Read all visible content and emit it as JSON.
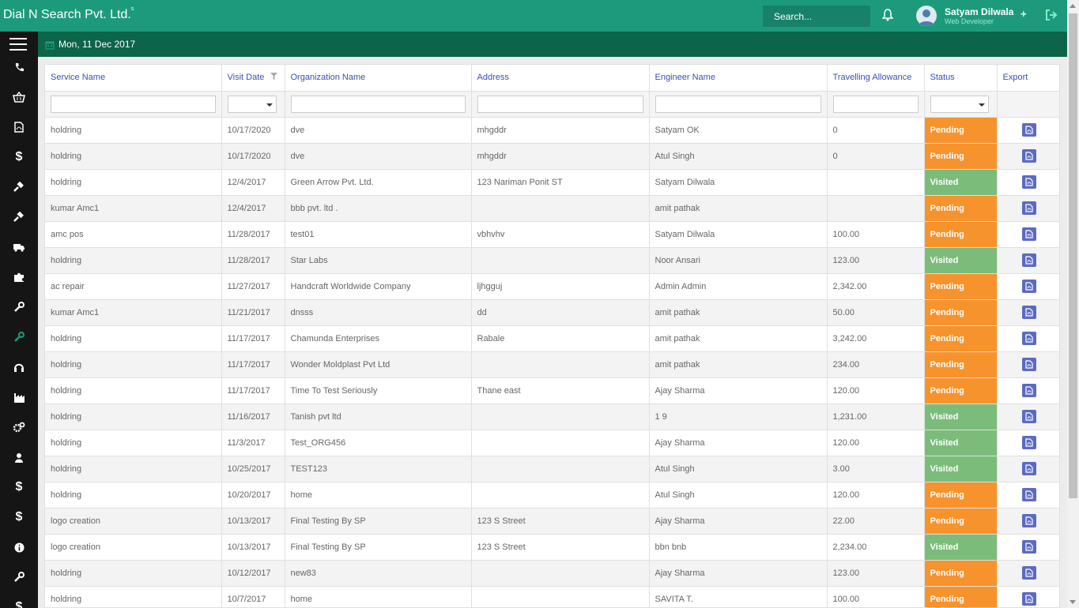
{
  "header": {
    "brand": "Dial N Search Pvt. Ltd.",
    "brand_sup": "s",
    "search_placeholder": "Search...",
    "user_name": "Satyam Dilwala",
    "user_role": "Web Developer",
    "accent_color": "#1d9a7c"
  },
  "subbar": {
    "date": "Mon, 11 Dec 2017",
    "color": "#0c6449"
  },
  "sidebar": {
    "icons": [
      "phone-icon",
      "basket-icon",
      "pdf-file-icon",
      "dollar-icon",
      "gavel-icon",
      "gavel-icon",
      "truck-icon",
      "puzzle-icon",
      "wrench-icon",
      "wrench-icon",
      "headphones-icon",
      "industry-icon",
      "cogs-icon",
      "user-icon",
      "dollar-icon",
      "dollar-icon",
      "info-icon",
      "wrench-icon",
      "dollar-icon"
    ]
  },
  "table": {
    "columns": [
      "Service Name",
      "Visit Date",
      "Organization Name",
      "Address",
      "Engineer Name",
      "Travelling Allowance",
      "Status",
      "Export"
    ],
    "rows": [
      [
        "holdring",
        "10/17/2020",
        "dve",
        "mhgddr",
        "Satyam OK",
        "0",
        "Pending"
      ],
      [
        "holdring",
        "10/17/2020",
        "dve",
        "mhgddr",
        "Atul Singh",
        "0",
        "Pending"
      ],
      [
        "holdring",
        "12/4/2017",
        "Green Arrow Pvt. Ltd.",
        "123 Nariman Ponit ST",
        "Satyam Dilwala",
        "",
        "Visited"
      ],
      [
        "kumar Amc1",
        "12/4/2017",
        "bbb pvt. ltd .",
        "",
        "amit pathak",
        "",
        "Pending"
      ],
      [
        "amc pos",
        "11/28/2017",
        "test01",
        "vbhvhv",
        "Satyam Dilwala",
        "100.00",
        "Pending"
      ],
      [
        "holdring",
        "11/28/2017",
        "Star Labs",
        "",
        "Noor Ansari",
        "123.00",
        "Visited"
      ],
      [
        "ac repair",
        "11/27/2017",
        "Handcraft Worldwide Company",
        "ljhgguj",
        "Admin Admin",
        "2,342.00",
        "Pending"
      ],
      [
        "kumar Amc1",
        "11/21/2017",
        "dnsss",
        "dd",
        "amit pathak",
        "50.00",
        "Pending"
      ],
      [
        "holdring",
        "11/17/2017",
        "Chamunda Enterprises",
        "Rabale",
        "amit pathak",
        "3,242.00",
        "Pending"
      ],
      [
        "holdring",
        "11/17/2017",
        "Wonder Moldplast Pvt Ltd",
        "",
        "amit pathak",
        "234.00",
        "Pending"
      ],
      [
        "holdring",
        "11/17/2017",
        "Time To Test Seriously",
        "Thane east",
        "Ajay Sharma",
        "120.00",
        "Pending"
      ],
      [
        "holdring",
        "11/16/2017",
        "Tanish pvt ltd",
        "",
        "1 9",
        "1,231.00",
        "Visited"
      ],
      [
        "holdring",
        "11/3/2017",
        "Test_ORG456",
        "",
        "Ajay Sharma",
        "120.00",
        "Visited"
      ],
      [
        "holdring",
        "10/25/2017",
        "TEST123",
        "",
        "Atul Singh",
        "3.00",
        "Visited"
      ],
      [
        "holdring",
        "10/20/2017",
        "home",
        "",
        "Atul Singh",
        "120.00",
        "Pending"
      ],
      [
        "logo creation",
        "10/13/2017",
        "Final Testing By SP",
        "123 S Street",
        "Ajay Sharma",
        "22.00",
        "Pending"
      ],
      [
        "logo creation",
        "10/13/2017",
        "Final Testing By SP",
        "123 S Street",
        "bbn bnb",
        "2,234.00",
        "Visited"
      ],
      [
        "holdring",
        "10/12/2017",
        "new83",
        "",
        "Ajay Sharma",
        "123.00",
        "Pending"
      ],
      [
        "holdring",
        "10/7/2017",
        "home",
        "",
        "SAVITA T.",
        "100.00",
        "Pending"
      ]
    ],
    "status_colors": {
      "Pending": "#f7932d",
      "Visited": "#7cbc7a"
    }
  }
}
